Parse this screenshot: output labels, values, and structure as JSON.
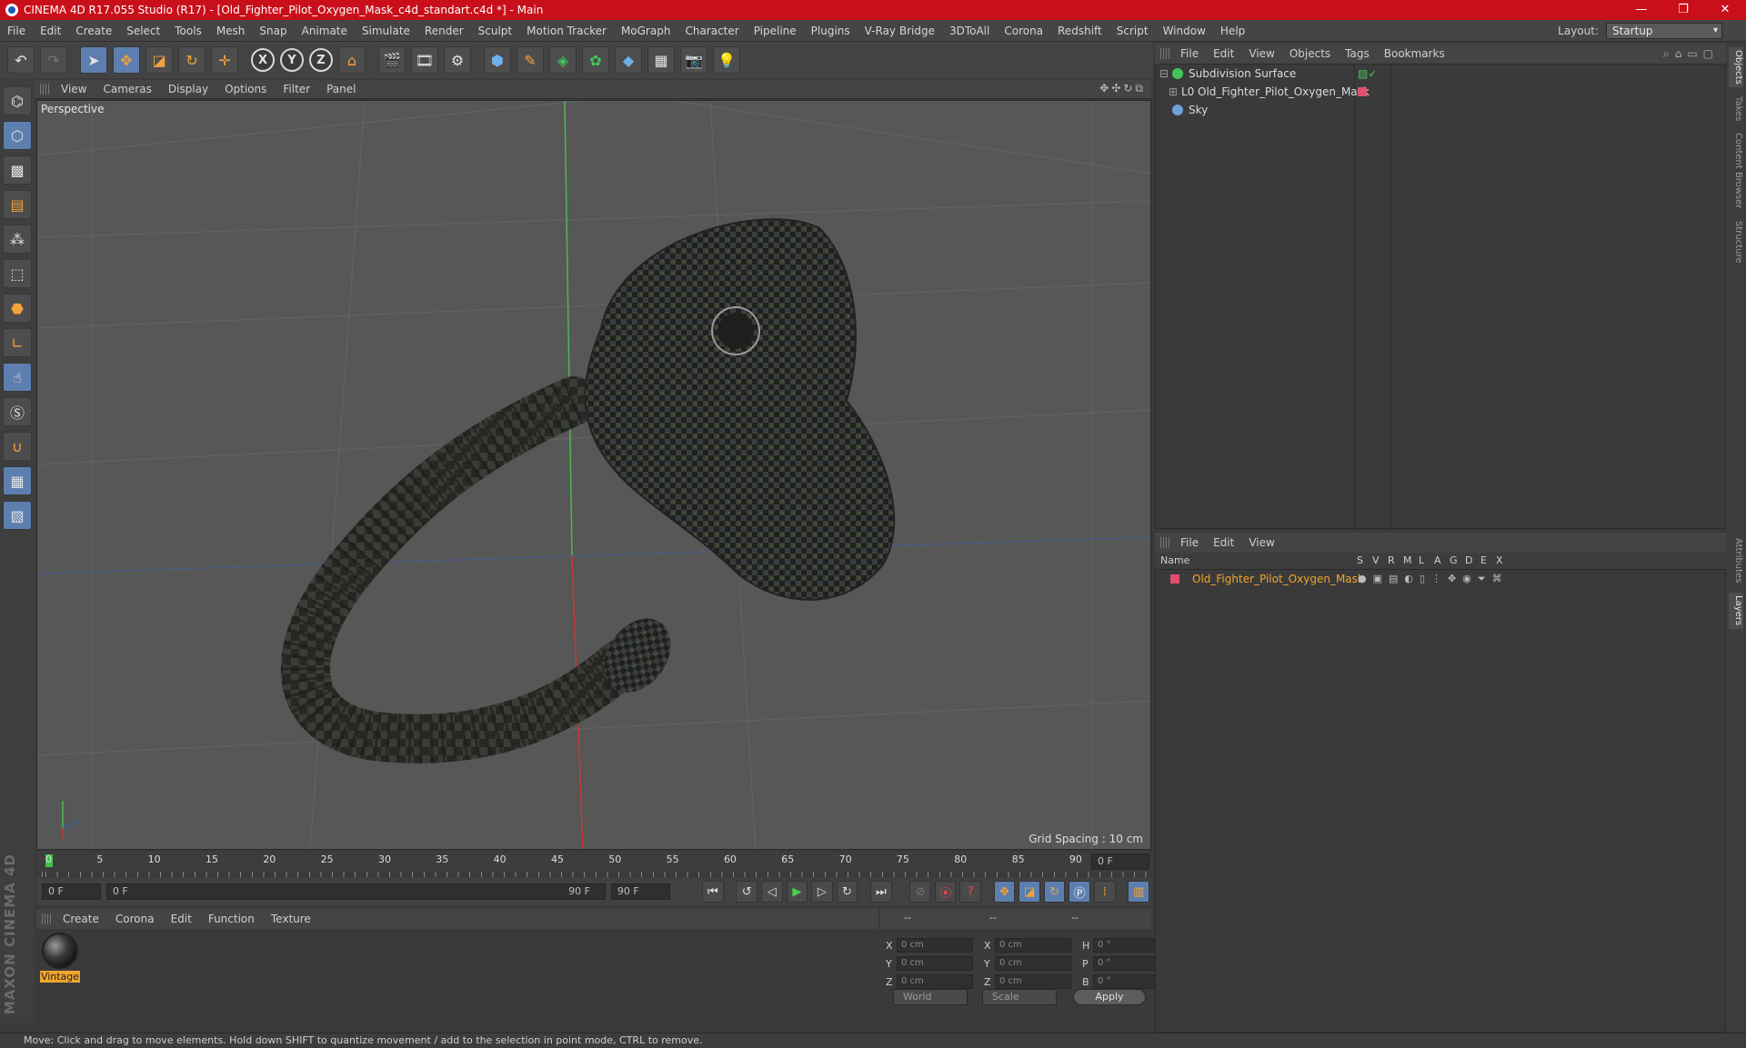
{
  "window": {
    "title": "CINEMA 4D R17.055 Studio (R17) - [Old_Fighter_Pilot_Oxygen_Mask_c4d_standart.c4d *] - Main",
    "min": "—",
    "max": "❐",
    "close": "✕"
  },
  "menu": [
    "File",
    "Edit",
    "Create",
    "Select",
    "Tools",
    "Mesh",
    "Snap",
    "Animate",
    "Simulate",
    "Render",
    "Sculpt",
    "Motion Tracker",
    "MoGraph",
    "Character",
    "Pipeline",
    "Plugins",
    "V-Ray Bridge",
    "3DToAll",
    "Corona",
    "Redshift",
    "Script",
    "Window",
    "Help"
  ],
  "layout": {
    "label": "Layout:",
    "value": "Startup"
  },
  "viewport": {
    "menu": [
      "View",
      "Cameras",
      "Display",
      "Options",
      "Filter",
      "Panel"
    ],
    "label": "Perspective",
    "grid_spacing": "Grid Spacing : 10 cm"
  },
  "timeline": {
    "ticks": [
      "0",
      "5",
      "10",
      "15",
      "20",
      "25",
      "30",
      "35",
      "40",
      "45",
      "50",
      "55",
      "60",
      "65",
      "70",
      "75",
      "80",
      "85",
      "90"
    ],
    "current_frame": "0 F",
    "start": "0 F",
    "range_start": "0 F",
    "range_end": "90 F",
    "end": "90 F"
  },
  "material_manager": {
    "menu": [
      "Create",
      "Corona",
      "Edit",
      "Function",
      "Texture"
    ],
    "materials": [
      {
        "name": "Vintage"
      }
    ]
  },
  "coordinates": {
    "header": [
      "--",
      "--",
      "--"
    ],
    "rows": [
      {
        "a1": "X",
        "v1": "0 cm",
        "a2": "X",
        "v2": "0 cm",
        "a3": "H",
        "v3": "0 °"
      },
      {
        "a1": "Y",
        "v1": "0 cm",
        "a2": "Y",
        "v2": "0 cm",
        "a3": "P",
        "v3": "0 °"
      },
      {
        "a1": "Z",
        "v1": "0 cm",
        "a2": "Z",
        "v2": "0 cm",
        "a3": "B",
        "v3": "0 °"
      }
    ],
    "mode1": "World",
    "mode2": "Scale",
    "apply": "Apply"
  },
  "object_manager": {
    "menu": [
      "File",
      "Edit",
      "View",
      "Objects",
      "Tags",
      "Bookmarks"
    ],
    "objects": [
      {
        "name": "Subdivision Surface",
        "color": "#45c45a"
      },
      {
        "name": "Old_Fighter_Pilot_Oxygen_Mask",
        "color": "#cfcfcf"
      },
      {
        "name": "Sky",
        "color": "#6fa0d8"
      }
    ]
  },
  "layer_manager": {
    "menu": [
      "File",
      "Edit",
      "View"
    ],
    "columns": [
      "Name",
      "S",
      "V",
      "R",
      "M",
      "L",
      "A",
      "G",
      "D",
      "E",
      "X"
    ],
    "layers": [
      {
        "name": "Old_Fighter_Pilot_Oxygen_Mask",
        "color": "#e0506e"
      }
    ]
  },
  "side_tabs": [
    "Objects",
    "Takes",
    "Content Browser",
    "Structure",
    "Attributes",
    "Layers"
  ],
  "status": "Move: Click and drag to move elements. Hold down SHIFT to quantize movement / add to the selection in point mode, CTRL to remove.",
  "branding": "MAXON CINEMA 4D",
  "colors": {
    "title_bar": "#c9101a",
    "accent": "#f0a52f",
    "selection": "#5d7fb0"
  }
}
